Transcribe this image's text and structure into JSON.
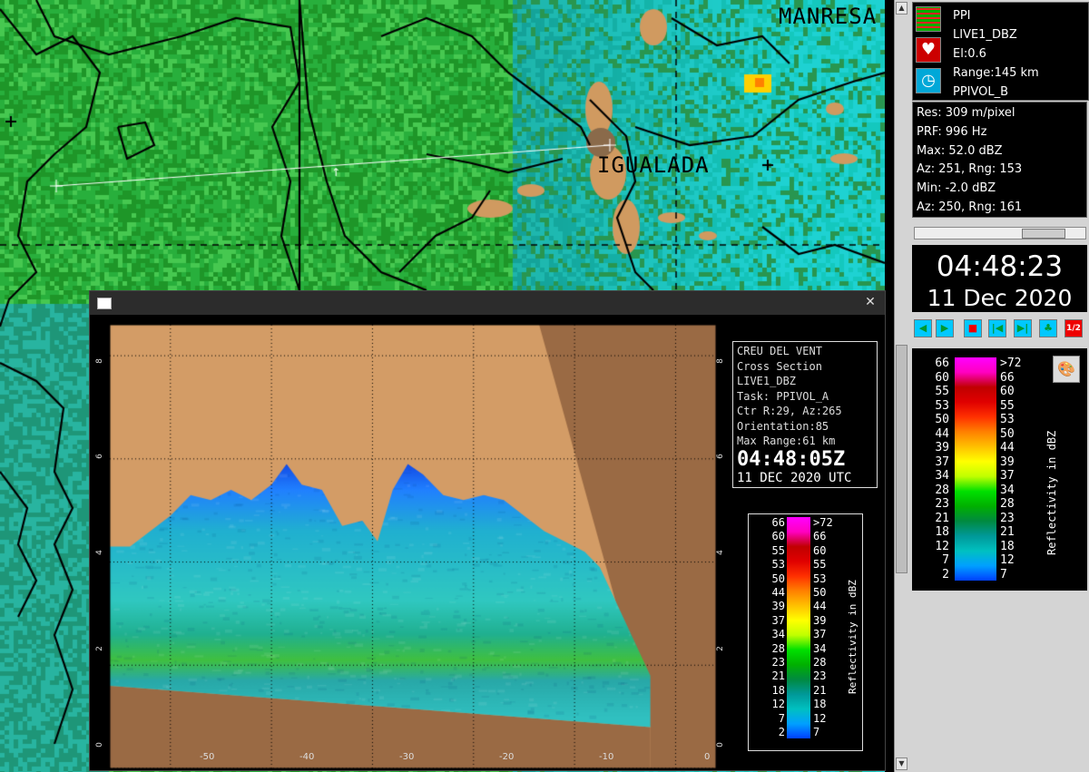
{
  "map": {
    "city_manresa": "MANRESA",
    "city_igualada": "IGUALADA"
  },
  "radar_info": {
    "lines": [
      "PPI",
      "LIVE1_DBZ",
      "El:0.6",
      "Range:145 km",
      "PPIVOL_B"
    ],
    "icons": [
      "ppi-grid-icon",
      "heart-ve-icon",
      "clock-icon"
    ]
  },
  "stats": [
    "Res: 309 m/pixel",
    "PRF: 996 Hz",
    "Max: 52.0 dBZ",
    "Az: 251, Rng: 153",
    "Min: -2.0 dBZ",
    "Az: 250, Rng: 161"
  ],
  "clock": {
    "time": "04:48:23",
    "date": "11 Dec 2020"
  },
  "controls": [
    "back-icon",
    "play-icon",
    "stop-icon",
    "first-frame-icon",
    "last-frame-icon",
    "tree-icon",
    "one-two-icon"
  ],
  "legend": {
    "left": [
      "66",
      "60",
      "55",
      "53",
      "50",
      "44",
      "39",
      "37",
      "34",
      "28",
      "23",
      "21",
      "18",
      "12",
      "7",
      "2"
    ],
    "right": [
      ">72",
      "66",
      "60",
      "55",
      "53",
      "50",
      "44",
      "39",
      "37",
      "34",
      "28",
      "23",
      "21",
      "18",
      "12",
      "7"
    ],
    "unit": "Reflectivity in dBZ",
    "colors": [
      "#ff00ff",
      "#ff00c0",
      "#c00000",
      "#e00000",
      "#ff3000",
      "#ff8000",
      "#ffc000",
      "#ffff00",
      "#c0ff00",
      "#00e000",
      "#00b000",
      "#008a40",
      "#009898",
      "#00c0c0",
      "#00a0ff",
      "#0040ff"
    ]
  },
  "cross_section": {
    "info": [
      "CREU DEL VENT",
      "Cross Section",
      "LIVE1_DBZ",
      "Task: PPIVOL_A",
      "Ctr R:29, Az:265",
      "Orientation:85",
      "Max Range:61 km"
    ],
    "time": "04:48:05Z",
    "date": "11 DEC 2020 UTC",
    "x_ticks": [
      "-50",
      "-40",
      "-30",
      "-20",
      "-10",
      "0"
    ],
    "y_ticks": [
      "0",
      "2",
      "4",
      "6",
      "8"
    ],
    "x_values": [
      -50,
      -40,
      -30,
      -20,
      -10,
      0
    ],
    "y_values": [
      0,
      2,
      4,
      6,
      8
    ]
  }
}
